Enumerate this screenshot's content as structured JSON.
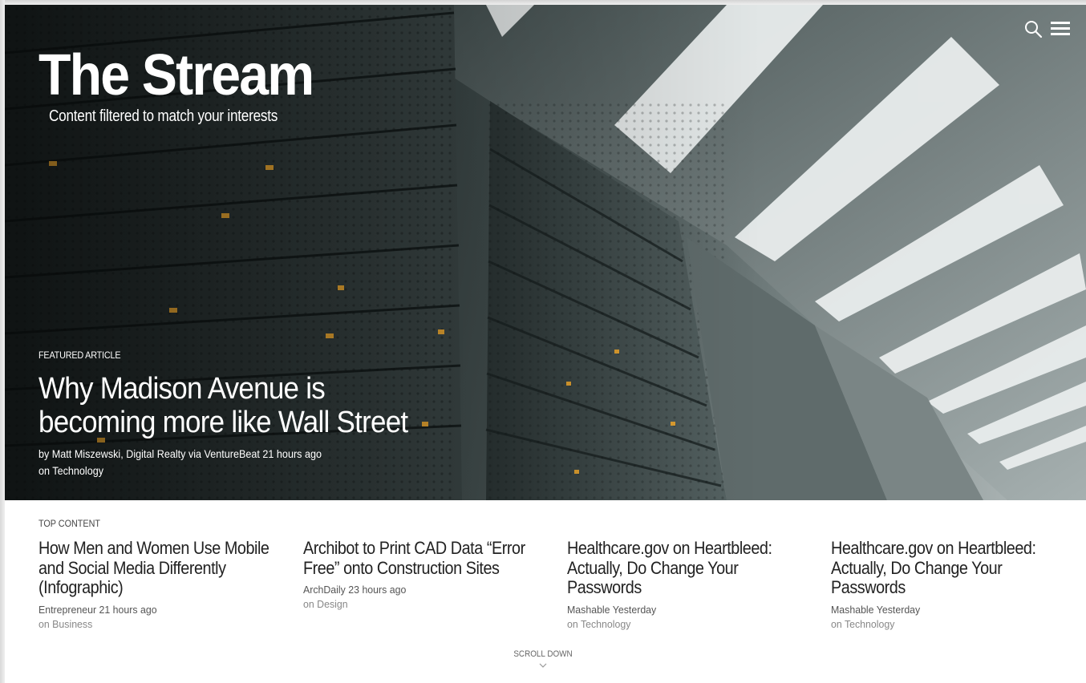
{
  "header": {
    "title": "The Stream",
    "subtitle": "Content filtered to match your interests",
    "search_icon": "search-icon",
    "menu_icon": "hamburger-menu-icon"
  },
  "featured": {
    "label": "FEATURED ARTICLE",
    "headline": "Why Madison Avenue is becoming more like Wall Street",
    "byline": "by Matt Miszewski, Digital Realty via VentureBeat 21 hours ago",
    "topic": "on Technology"
  },
  "top_content": {
    "label": "TOP CONTENT",
    "items": [
      {
        "title": "How Men and Women Use Mobile and Social Media Differently (Infographic)",
        "source": "Entrepreneur 21 hours ago",
        "topic": "on Business"
      },
      {
        "title": "Archibot to Print CAD Data “Error Free” onto Construction Sites",
        "source": "ArchDaily 23 hours ago",
        "topic": "on Design"
      },
      {
        "title": "Healthcare.gov on Heartbleed: Actually, Do Change Your Passwords",
        "source": "Mashable Yesterday",
        "topic": "on Technology"
      },
      {
        "title": "Healthcare.gov on Heartbleed: Actually, Do Change Your Passwords",
        "source": "Mashable Yesterday",
        "topic": "on Technology"
      }
    ]
  },
  "footer": {
    "scroll_label": "SCROLL DOWN",
    "scroll_icon": "chevron-down-icon"
  }
}
